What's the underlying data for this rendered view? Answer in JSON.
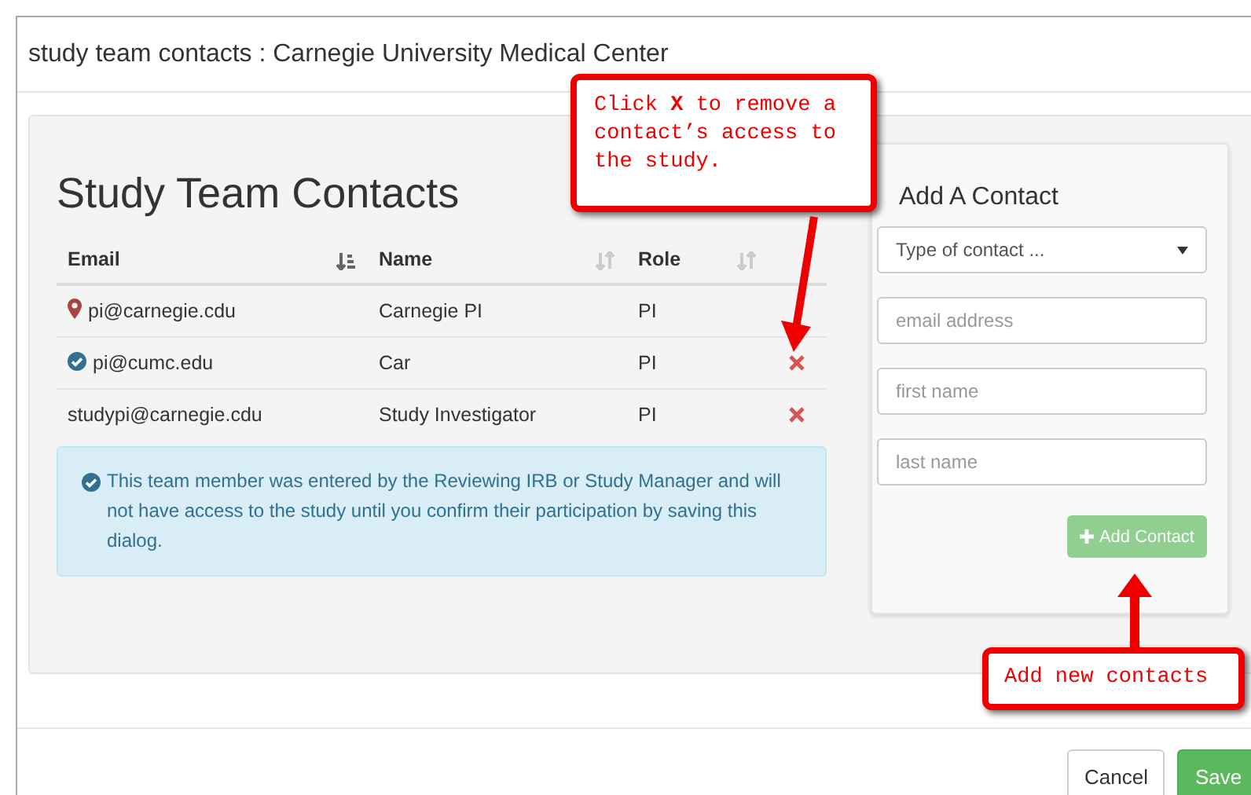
{
  "window": {
    "title": "study team contacts : Carnegie University Medical Center"
  },
  "contacts": {
    "title": "Study Team Contacts",
    "columns": [
      {
        "label": "Email",
        "sorted": true
      },
      {
        "label": "Name",
        "sorted": false
      },
      {
        "label": "Role",
        "sorted": false
      }
    ],
    "rows": [
      {
        "kind": "pin",
        "email": "pi@carnegie.cdu",
        "name": "Carnegie PI",
        "role": "PI",
        "removable": false
      },
      {
        "kind": "verified",
        "email": "pi@cumc.edu",
        "name": "Car",
        "role": "PI",
        "removable": true
      },
      {
        "kind": "plain",
        "email": "studypi@carnegie.cdu",
        "name": "Study Investigator",
        "role": "PI",
        "removable": true
      }
    ],
    "notice": "This team member was entered by the Reviewing IRB or Study Manager and will not have access to the study until you confirm their participation by saving this dialog."
  },
  "add_contact": {
    "title": "Add A Contact",
    "type_select": {
      "placeholder": "Type of contact ..."
    },
    "fields": [
      {
        "placeholder": "email address"
      },
      {
        "placeholder": "first name"
      },
      {
        "placeholder": "last name"
      }
    ],
    "button": {
      "label": "Add Contact",
      "disabled": true
    }
  },
  "footer": {
    "buttons": [
      {
        "label": "Cancel",
        "kind": "default"
      },
      {
        "label": "Save",
        "kind": "primary"
      }
    ]
  },
  "callouts": [
    {
      "text": "Click **X** to remove a contact’s access to the study.",
      "kind": "remove"
    },
    {
      "text": "Add new contacts",
      "kind": "add"
    }
  ]
}
